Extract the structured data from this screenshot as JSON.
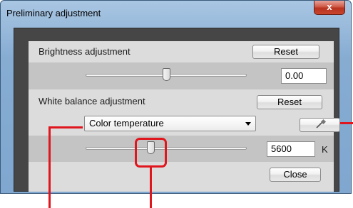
{
  "window": {
    "title": "Preliminary adjustment",
    "close_glyph": "x"
  },
  "brightness": {
    "label": "Brightness adjustment",
    "reset_label": "Reset",
    "value": "0.00",
    "slider_position": 0.5
  },
  "white_balance": {
    "label": "White balance adjustment",
    "reset_label": "Reset",
    "mode_selected": "Color temperature",
    "eyedropper_icon": "eyedropper-icon",
    "temperature_value": "5600",
    "temperature_unit": "K",
    "slider_position": 0.4
  },
  "footer": {
    "close_label": "Close"
  },
  "annotations": {
    "color": "#e0161e"
  }
}
